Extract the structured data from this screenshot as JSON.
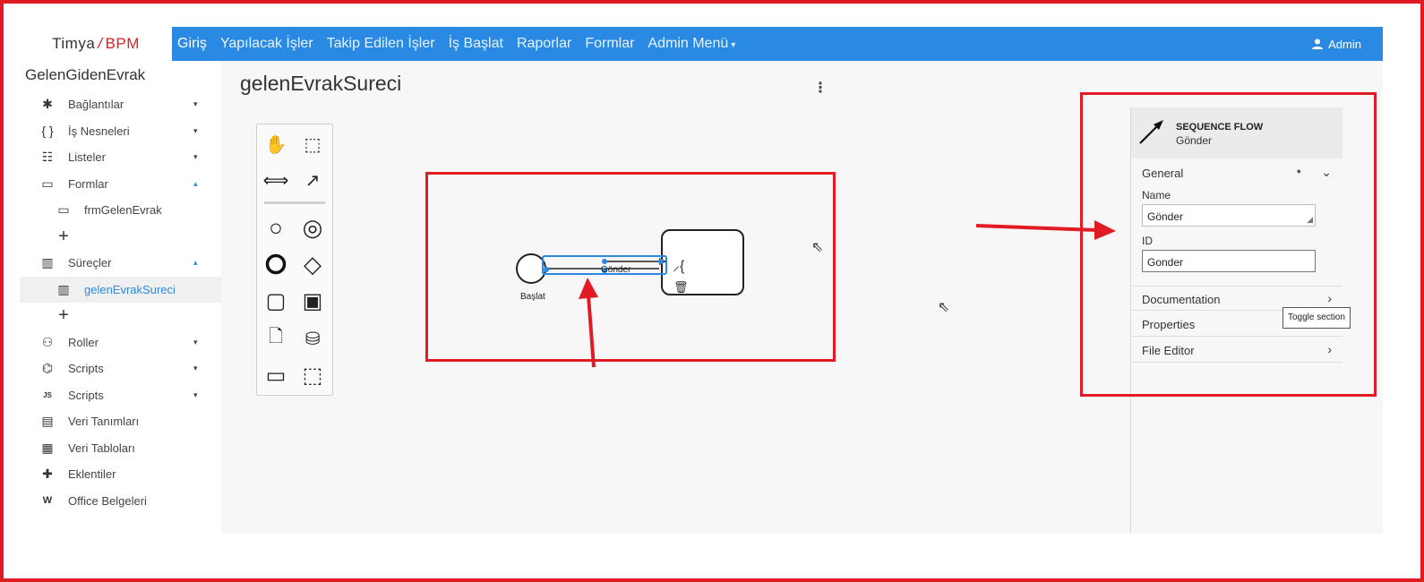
{
  "app": {
    "logo_prefix": "Timya",
    "logo_slash": "/",
    "logo_suffix": "BPM",
    "nav": [
      "Giriş",
      "Yapılacak İşler",
      "Takip Edilen İşler",
      "İş Başlat",
      "Raporlar",
      "Formlar",
      "Admin Menü"
    ],
    "admin_caret": "▾",
    "user_label": "Admin",
    "accent_color": "#2a8ae3",
    "annotation_color": "#e01b24"
  },
  "sidebar": {
    "project": "GelenGidenEvrak",
    "items": [
      {
        "label": "Bağlantılar",
        "icon": "bluetooth-icon",
        "glyph": "✱",
        "arrow": "▾"
      },
      {
        "label": "İş Nesneleri",
        "icon": "braces-icon",
        "glyph": "{ }",
        "arrow": "▾"
      },
      {
        "label": "Listeler",
        "icon": "list-icon",
        "glyph": "☷",
        "arrow": "▾"
      },
      {
        "label": "Formlar",
        "icon": "form-icon",
        "glyph": "▭",
        "arrow": "▴"
      },
      {
        "label": "frmGelenEvrak",
        "icon": "window-icon",
        "glyph": "▭"
      },
      {
        "label": "",
        "icon": "add-icon",
        "glyph": "+"
      },
      {
        "label": "Süreçler",
        "icon": "map-icon",
        "glyph": "▥",
        "arrow": "▴"
      },
      {
        "label": "gelenEvrakSureci",
        "icon": "map-icon",
        "glyph": "▥"
      },
      {
        "label": "",
        "icon": "add-icon",
        "glyph": "+"
      },
      {
        "label": "Roller",
        "icon": "people-icon",
        "glyph": "⚇",
        "arrow": "▾"
      },
      {
        "label": "Scripts",
        "icon": "code-file-icon",
        "glyph": "⌬",
        "arrow": "▾"
      },
      {
        "label": "Scripts",
        "icon": "js-icon",
        "glyph": "JS",
        "arrow": "▾"
      },
      {
        "label": "Veri Tanımları",
        "icon": "sd-card-icon",
        "glyph": "▤"
      },
      {
        "label": "Veri Tabloları",
        "icon": "table-icon",
        "glyph": "▦"
      },
      {
        "label": "Eklentiler",
        "icon": "puzzle-icon",
        "glyph": "✚"
      },
      {
        "label": "Office Belgeleri",
        "icon": "word-icon",
        "glyph": "W"
      }
    ]
  },
  "canvas": {
    "title": "gelenEvrakSureci",
    "more_glyph": "⋮",
    "palette": [
      {
        "name": "hand-tool-icon",
        "glyph": "✋"
      },
      {
        "name": "lasso-tool-icon",
        "glyph": "⬚"
      },
      {
        "name": "space-tool-icon",
        "glyph": "⟺"
      },
      {
        "name": "connect-tool-icon",
        "glyph": "↗"
      },
      {
        "name": "start-event-icon",
        "glyph": "○"
      },
      {
        "name": "intermediate-event-icon",
        "glyph": "◎"
      },
      {
        "name": "end-event-icon",
        "glyph": "●"
      },
      {
        "name": "gateway-icon",
        "glyph": "◇"
      },
      {
        "name": "task-icon",
        "glyph": "▢"
      },
      {
        "name": "subprocess-icon",
        "glyph": "▣"
      },
      {
        "name": "data-object-icon",
        "glyph": "🗋"
      },
      {
        "name": "data-store-icon",
        "glyph": "⛁"
      },
      {
        "name": "pool-icon",
        "glyph": "▭"
      },
      {
        "name": "group-icon",
        "glyph": "⬚"
      }
    ],
    "start_label": "Başlat",
    "flow_label": "Gönder"
  },
  "panel": {
    "type": "SEQUENCE FLOW",
    "element_name": "Gönder",
    "general": "General",
    "name_label": "Name",
    "name_value": "Gönder",
    "id_label": "ID",
    "id_value": "Gonder",
    "documentation": "Documentation",
    "properties": "Properties",
    "file_editor": "File Editor",
    "tooltip": "Toggle section",
    "chevron_open": "⌄",
    "chevron_closed": "›",
    "dot": "●"
  }
}
